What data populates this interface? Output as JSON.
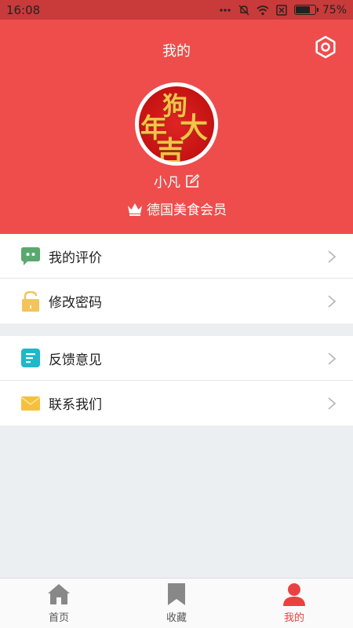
{
  "status_bar": {
    "time": "16:08",
    "battery": "75%",
    "battery_fraction": 0.75
  },
  "header": {
    "title": "我的"
  },
  "profile": {
    "username": "小凡",
    "membership": "德国美食会员",
    "avatar_text": [
      "狗",
      "年",
      "大",
      "吉"
    ]
  },
  "menu": {
    "group1": [
      {
        "label": "我的评价",
        "icon": "chat-icon"
      },
      {
        "label": "修改密码",
        "icon": "lock-icon"
      }
    ],
    "group2": [
      {
        "label": "反馈意见",
        "icon": "feedback-icon"
      },
      {
        "label": "联系我们",
        "icon": "mail-icon"
      }
    ]
  },
  "tabs": [
    {
      "label": "首页",
      "icon": "home-icon"
    },
    {
      "label": "收藏",
      "icon": "bookmark-icon"
    },
    {
      "label": "我的",
      "icon": "person-icon",
      "active": true
    }
  ],
  "colors": {
    "brand": "#ee4d4c",
    "active_tab": "#e94141",
    "chat": "#5aa86e",
    "lock": "#f3c45b",
    "feedback": "#1fb8c9",
    "mail": "#f5c13c"
  }
}
